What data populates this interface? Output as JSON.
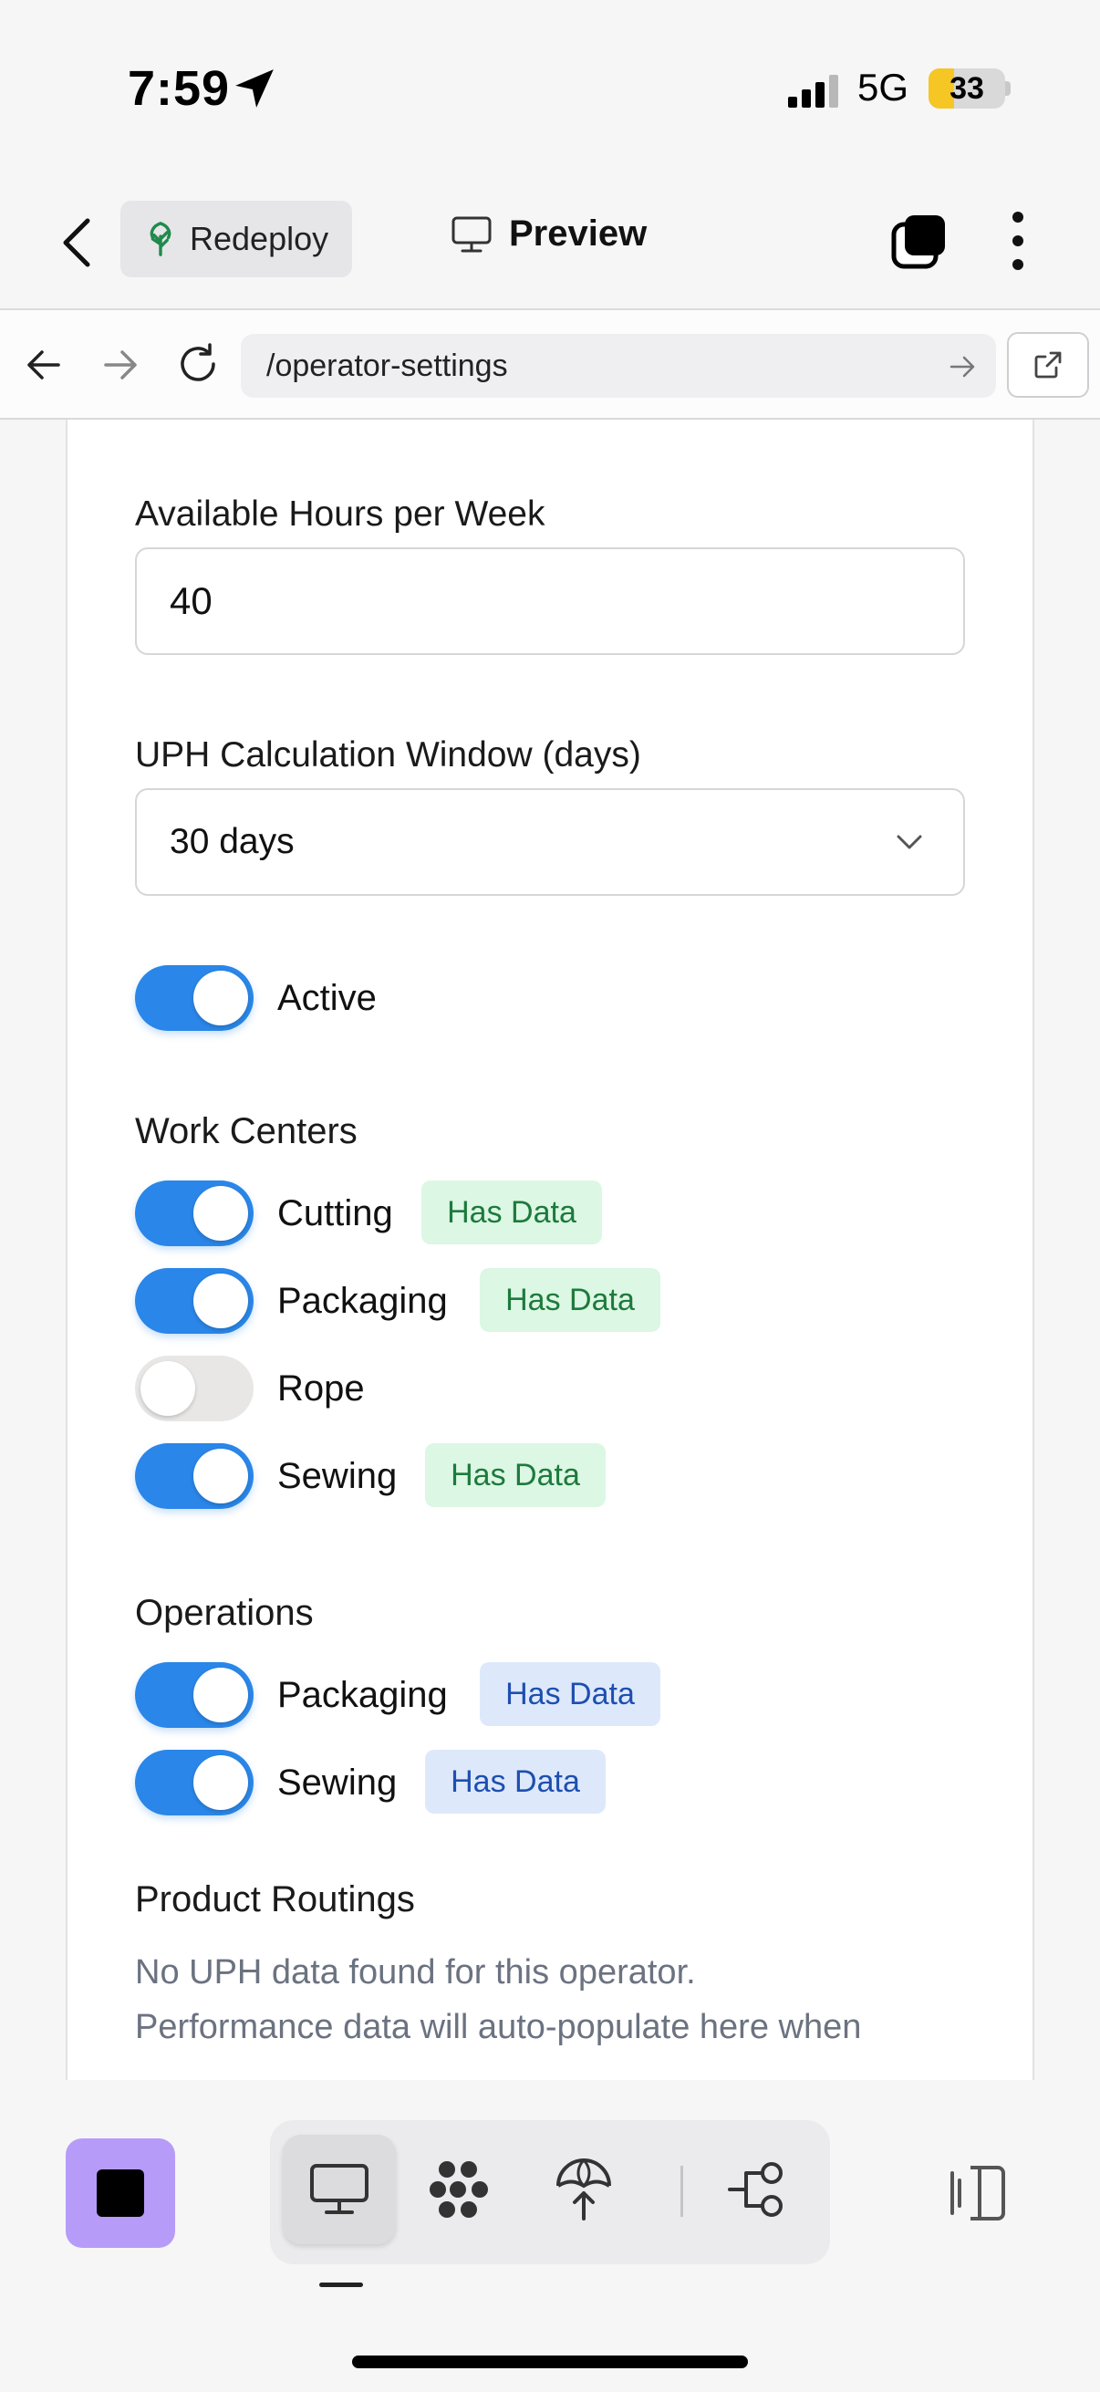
{
  "status_bar": {
    "time": "7:59",
    "network": "5G",
    "battery_level": "33",
    "battery_fraction": 0.33,
    "battery_color": "#f6c624"
  },
  "header": {
    "redeploy_label": "Redeploy",
    "preview_label": "Preview",
    "icons": [
      "back-chevron-icon",
      "tree-icon",
      "monitor-icon",
      "tabs-icon",
      "more-vertical-icon"
    ]
  },
  "browser": {
    "url": "/operator-settings",
    "icons": [
      "arrow-left-icon",
      "arrow-right-icon",
      "reload-icon",
      "go-arrow-icon",
      "external-link-icon"
    ]
  },
  "form": {
    "hours_label": "Available Hours per Week",
    "hours_value": "40",
    "window_label": "UPH Calculation Window (days)",
    "window_value": "30 days",
    "active_label": "Active",
    "active_on": true
  },
  "work_centers": {
    "title": "Work Centers",
    "items": [
      {
        "label": "Cutting",
        "on": true,
        "badge": "Has Data"
      },
      {
        "label": "Packaging",
        "on": true,
        "badge": "Has Data"
      },
      {
        "label": "Rope",
        "on": false,
        "badge": ""
      },
      {
        "label": "Sewing",
        "on": true,
        "badge": "Has Data"
      }
    ]
  },
  "operations": {
    "title": "Operations",
    "items": [
      {
        "label": "Packaging",
        "on": true,
        "badge": "Has Data"
      },
      {
        "label": "Sewing",
        "on": true,
        "badge": "Has Data"
      }
    ]
  },
  "product_routings": {
    "title": "Product Routings",
    "message_line1": "No UPH data found for this operator.",
    "message_line2": "Performance data will auto-populate here when"
  },
  "colors": {
    "toggle_on": "#2a86e8",
    "badge_green_bg": "#dcf7e4",
    "badge_blue_bg": "#dde9fb",
    "stop_button": "#b69cf8"
  },
  "toolbar": {
    "icons": [
      "stop-icon",
      "desktop-icon",
      "cluster-icon",
      "deploy-icon",
      "workflow-icon",
      "side-panel-icon"
    ]
  }
}
